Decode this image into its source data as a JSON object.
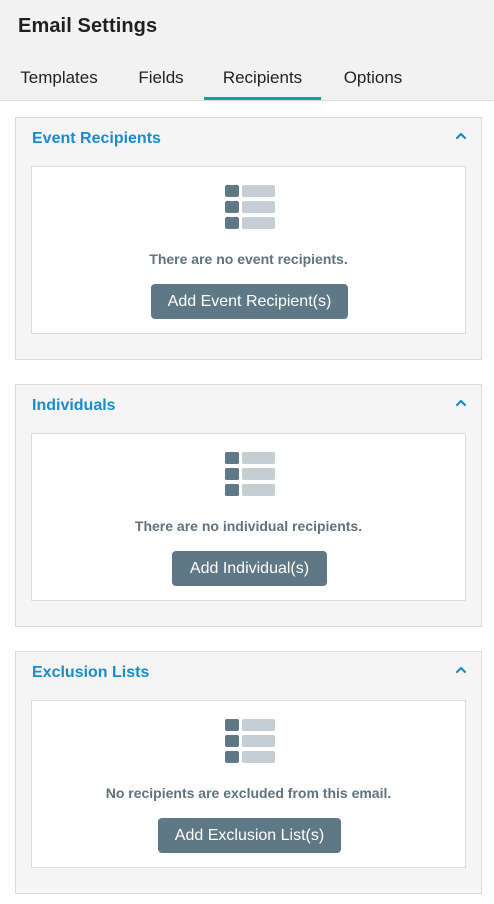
{
  "header": {
    "title": "Email Settings"
  },
  "tabs": [
    {
      "label": "Templates"
    },
    {
      "label": "Fields"
    },
    {
      "label": "Recipients",
      "active": true
    },
    {
      "label": "Options"
    }
  ],
  "panels": {
    "event": {
      "title": "Event Recipients",
      "empty_text": "There are no event recipients.",
      "button_label": "Add Event Recipient(s)"
    },
    "individuals": {
      "title": "Individuals",
      "empty_text": "There are no individual recipients.",
      "button_label": "Add Individual(s)"
    },
    "exclusion": {
      "title": "Exclusion Lists",
      "empty_text": "No recipients are excluded from this email.",
      "button_label": "Add Exclusion List(s)"
    }
  },
  "icons": {
    "collapse": "chevron-up-icon",
    "empty_state": "list-icon"
  },
  "colors": {
    "accent_tab": "#12a39a",
    "panel_title": "#1a8ccc",
    "button_bg": "#5f7885",
    "empty_text": "#5f727e"
  }
}
